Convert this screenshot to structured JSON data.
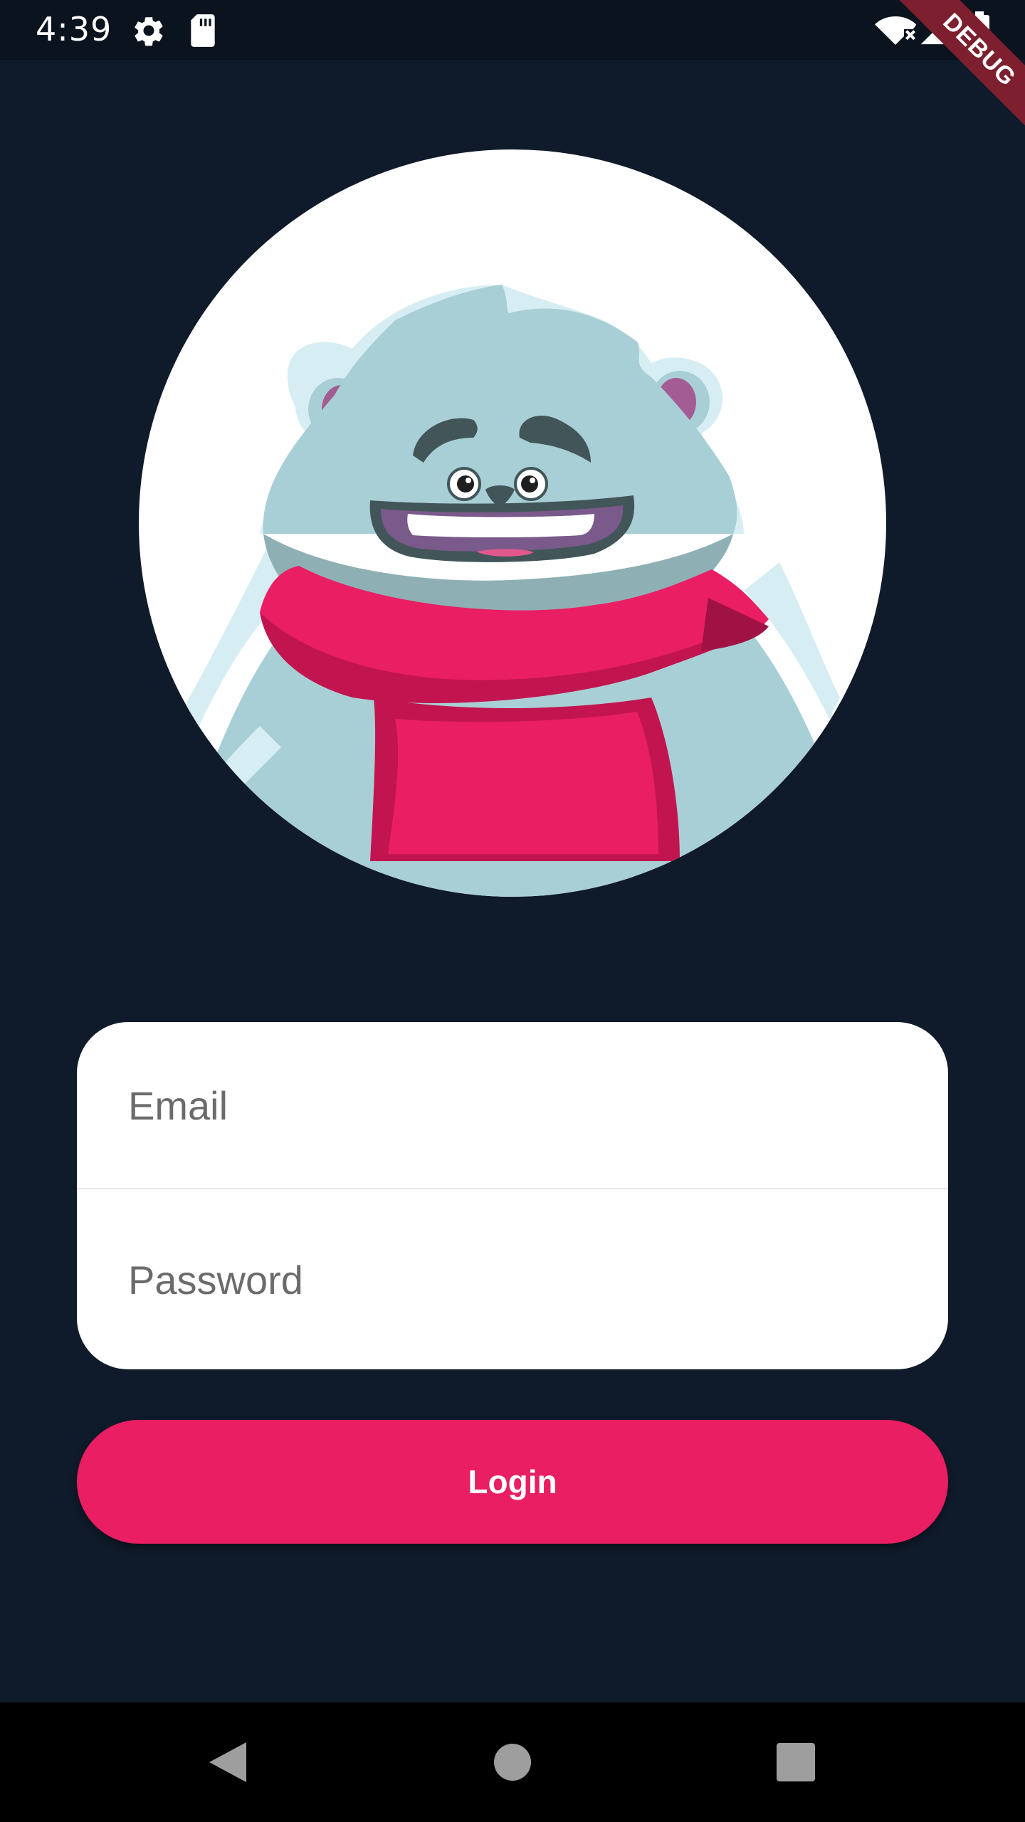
{
  "status_bar": {
    "time": "4:39",
    "icons": [
      "settings-icon",
      "sd-card-icon",
      "wifi-off-icon",
      "signal-icon",
      "battery-icon"
    ]
  },
  "debug_banner": {
    "label": "DEBUG",
    "color": "#7d1f2e"
  },
  "avatar": {
    "icon": "yeti-mascot-illustration"
  },
  "form": {
    "email_placeholder": "Email",
    "password_placeholder": "Password"
  },
  "login_button": {
    "label": "Login",
    "color": "#e91e63"
  },
  "nav_bar": {
    "icons": [
      "back-icon",
      "home-icon",
      "recents-icon"
    ]
  },
  "colors": {
    "background": "#0f1a2a",
    "accent": "#e91e63",
    "card": "#ffffff"
  }
}
